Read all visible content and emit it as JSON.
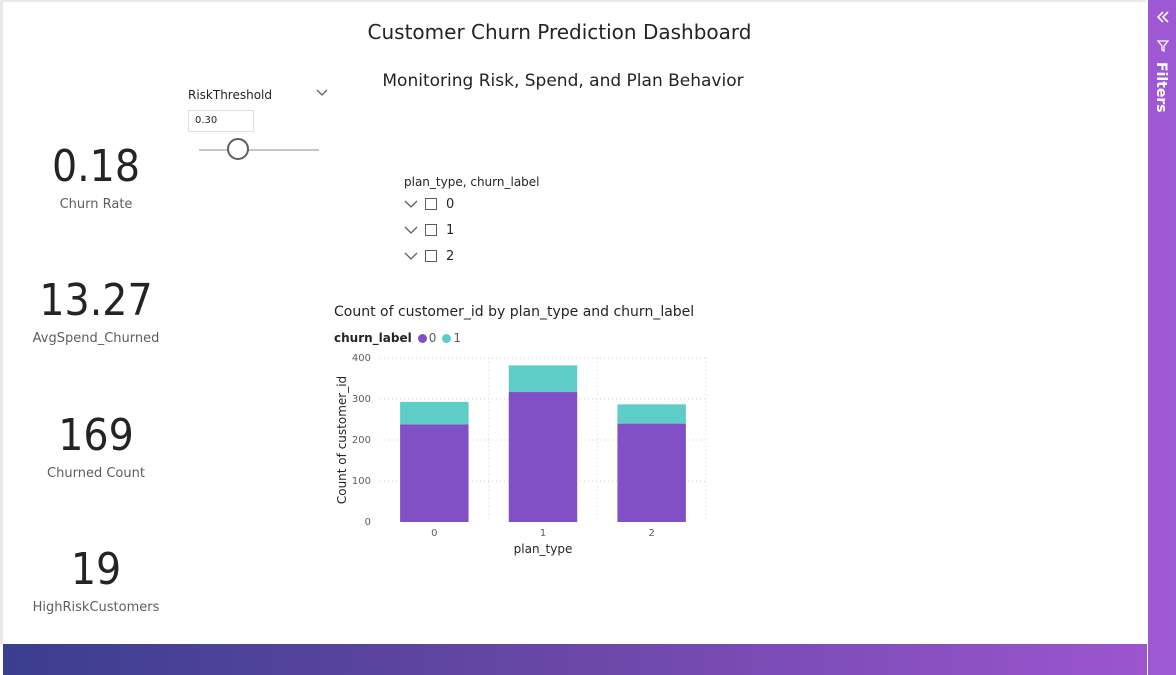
{
  "report": {
    "title": "Customer Churn Prediction Dashboard",
    "subtitle": "Monitoring Risk, Spend, and Plan Behavior"
  },
  "cards": [
    {
      "value": "0.18",
      "label": "Churn Rate"
    },
    {
      "value": "13.27",
      "label": "AvgSpend_Churned"
    },
    {
      "value": "169",
      "label": "Churned Count"
    },
    {
      "value": "19",
      "label": "HighRiskCustomers"
    }
  ],
  "slicer": {
    "label": "RiskThreshold",
    "value": "0.30",
    "slider_fraction": 0.3,
    "icon": "chevron-down-icon"
  },
  "hierarchy": {
    "header": "plan_type, churn_label",
    "items": [
      "0",
      "1",
      "2"
    ]
  },
  "filters_pane": {
    "label": "Filters",
    "collapse_icon": "double-chevron-left-icon",
    "filter_icon": "funnel-icon",
    "accent": "#9f58d3"
  },
  "colors": {
    "series0": "#8150c6",
    "series1": "#5ecdc8"
  },
  "chart_data": {
    "type": "bar",
    "stacked": true,
    "title": "Count of customer_id by plan_type and churn_label",
    "legend_title": "churn_label",
    "legend_placement": "top-left",
    "xlabel": "plan_type",
    "ylabel": "Count of customer_id",
    "categories": [
      "0",
      "1",
      "2"
    ],
    "series": [
      {
        "name": "0",
        "values": [
          238,
          317,
          240
        ]
      },
      {
        "name": "1",
        "values": [
          55,
          65,
          47
        ]
      }
    ],
    "ylim": [
      0,
      400
    ],
    "yticks": [
      "0",
      "100",
      "200",
      "300",
      "400"
    ],
    "grid": true
  }
}
